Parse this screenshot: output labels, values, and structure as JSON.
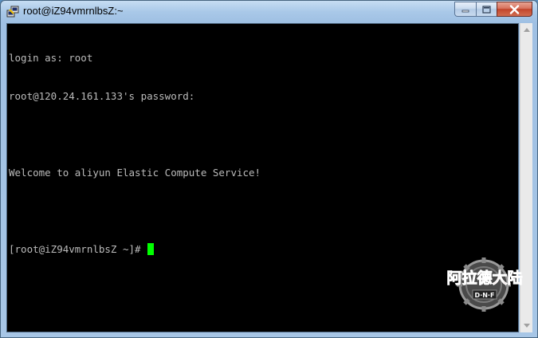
{
  "window": {
    "title": "root@iZ94vmrnlbsZ:~"
  },
  "terminal": {
    "lines": [
      "login as: root",
      "root@120.24.161.133's password:",
      "",
      "Welcome to aliyun Elastic Compute Service!",
      "",
      "[root@iZ94vmrnlbsZ ~]#"
    ]
  },
  "overlay": {
    "logo_text": "阿拉德大陆",
    "logo_sub": "D·N·F"
  },
  "colors": {
    "terminal_bg": "#000000",
    "terminal_fg": "#bbbbbb",
    "cursor": "#00ff00",
    "close_button": "#c2452b"
  },
  "icons": {
    "app": "putty-icon",
    "minimize": "minimize-icon",
    "maximize": "maximize-icon",
    "close": "close-icon"
  }
}
